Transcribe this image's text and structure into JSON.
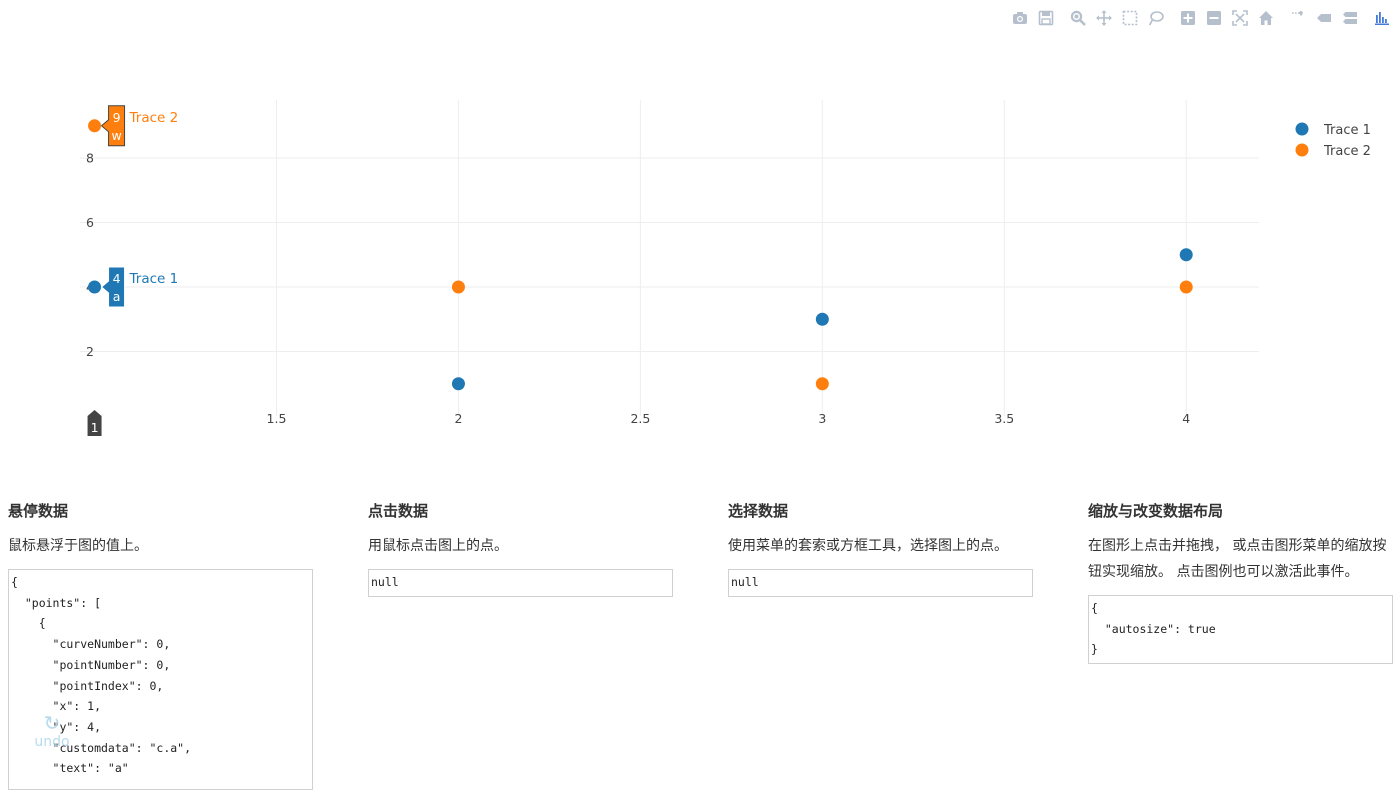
{
  "modebar": {
    "buttons": [
      {
        "name": "camera-icon",
        "title": "Download plot as a png"
      },
      {
        "name": "save-icon",
        "title": "Save and edit plot"
      },
      {
        "name": "zoom-icon",
        "title": "Zoom"
      },
      {
        "name": "pan-icon",
        "title": "Pan"
      },
      {
        "name": "box-select-icon",
        "title": "Box Select"
      },
      {
        "name": "lasso-select-icon",
        "title": "Lasso Select"
      },
      {
        "name": "zoom-in-icon",
        "title": "Zoom in"
      },
      {
        "name": "zoom-out-icon",
        "title": "Zoom out"
      },
      {
        "name": "autoscale-icon",
        "title": "Autoscale"
      },
      {
        "name": "home-icon",
        "title": "Reset axes"
      },
      {
        "name": "spike-lines-icon",
        "title": "Toggle Spike Lines"
      },
      {
        "name": "hover-closest-icon",
        "title": "Show closest data on hover"
      },
      {
        "name": "hover-compare-icon",
        "title": "Compare data on hover"
      },
      {
        "name": "plotly-logo-icon",
        "title": "Produced with Plotly"
      }
    ],
    "icon_color": "#b5c0cc",
    "logo_color": "#447adb"
  },
  "chart_data": {
    "type": "scatter",
    "xlim": [
      0.96,
      4.2
    ],
    "ylim": [
      0,
      9.8
    ],
    "xticks": [
      1.5,
      2,
      2.5,
      3,
      3.5,
      4
    ],
    "yticks": [
      2,
      4,
      6,
      8
    ],
    "grid": true,
    "legend_position": "top-right",
    "series": [
      {
        "name": "Trace 1",
        "color": "#1f77b4",
        "x": [
          1,
          2,
          3,
          4
        ],
        "y": [
          4,
          1,
          3,
          5
        ]
      },
      {
        "name": "Trace 2",
        "color": "#ff7f0e",
        "x": [
          1,
          2,
          3,
          4
        ],
        "y": [
          9,
          4,
          1,
          4
        ]
      }
    ],
    "hover": {
      "x_label": "1",
      "labels": [
        {
          "series": 0,
          "x": 1,
          "y": 4,
          "value": "4",
          "text": "a",
          "name": "Trace 1"
        },
        {
          "series": 1,
          "x": 1,
          "y": 9,
          "value": "9",
          "text": "w",
          "name": "Trace 2"
        }
      ]
    }
  },
  "panels": {
    "hover": {
      "title": "悬停数据",
      "desc": "鼠标悬浮于图的值上。",
      "code": "{\n  \"points\": [\n    {\n      \"curveNumber\": 0,\n      \"pointNumber\": 0,\n      \"pointIndex\": 0,\n      \"x\": 1,\n      \"y\": 4,\n      \"customdata\": \"c.a\",\n      \"text\": \"a\""
    },
    "click": {
      "title": "点击数据",
      "desc": "用鼠标点击图上的点。",
      "code": "null"
    },
    "select": {
      "title": "选择数据",
      "desc": "使用菜单的套索或方框工具，选择图上的点。",
      "code": "null"
    },
    "relayout": {
      "title": "缩放与改变数据布局",
      "desc": "在图形上点击并拖拽， 或点击图形菜单的缩放按钮实现缩放。 点击图例也可以激活此事件。",
      "code": "{\n  \"autosize\": true\n}"
    }
  },
  "undo": {
    "label": "undo"
  }
}
